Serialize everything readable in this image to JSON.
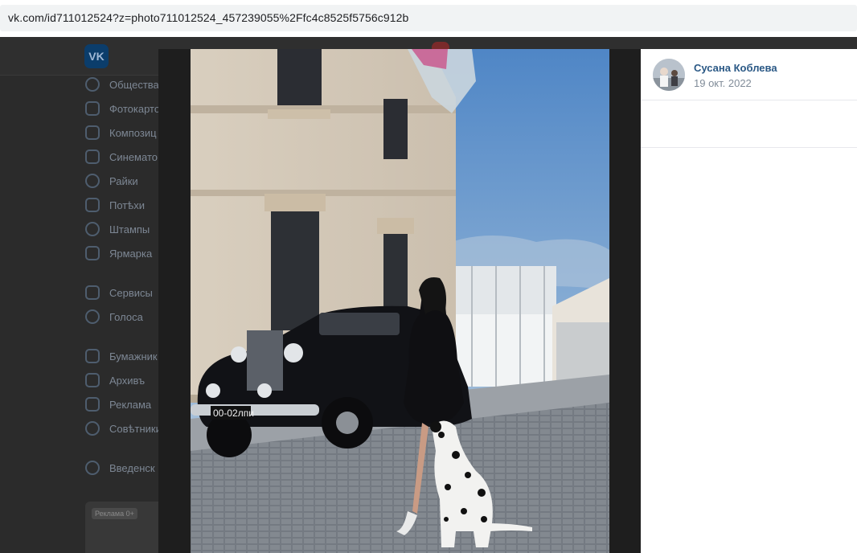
{
  "browser": {
    "url": "vk.com/id711012524?z=photo711012524_457239055%2Ffc4c8525f5756c912b"
  },
  "vk": {
    "logo": "VK",
    "menu": [
      {
        "label": "Общества",
        "icon": "users-icon"
      },
      {
        "label": "Фотокарто",
        "icon": "photo-icon"
      },
      {
        "label": "Композиц",
        "icon": "music-icon"
      },
      {
        "label": "Синемато",
        "icon": "video-icon"
      },
      {
        "label": "Райки",
        "icon": "clips-icon"
      },
      {
        "label": "Потѣхи",
        "icon": "games-icon"
      },
      {
        "label": "Штампы",
        "icon": "stickers-icon"
      },
      {
        "label": "Ярмарка",
        "icon": "market-icon"
      },
      {
        "label": "Сервисы",
        "icon": "services-icon"
      },
      {
        "label": "Голоса",
        "icon": "votes-icon"
      },
      {
        "label": "Бумажник",
        "icon": "bookmarks-icon"
      },
      {
        "label": "Архивъ",
        "icon": "files-icon"
      },
      {
        "label": "Реклама",
        "icon": "ads-icon"
      },
      {
        "label": "Совѣтники",
        "icon": "help-icon"
      },
      {
        "label": "Введенск",
        "icon": "groups-icon"
      }
    ],
    "ad_chip": "Реклама 0+"
  },
  "photo_viewer": {
    "author_name": "Сусана Коблева",
    "post_date": "19 окт. 2022",
    "plate_text": "00-02лпи"
  },
  "colors": {
    "link": "#2a5885",
    "muted": "#818c99",
    "viewer_bg": "#1e1e1e"
  }
}
